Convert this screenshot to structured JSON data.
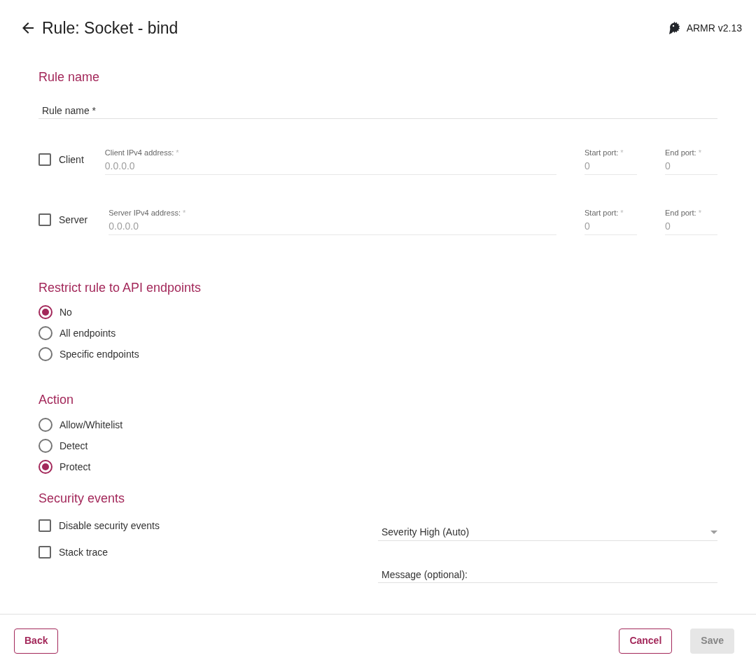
{
  "header": {
    "title": "Rule: Socket - bind",
    "version": "ARMR v2.13"
  },
  "rule_name": {
    "heading": "Rule name",
    "field": {
      "placeholder": "Rule name *"
    }
  },
  "endpoints": [
    {
      "label": "Client",
      "checked": false,
      "fields": [
        {
          "kind": "address",
          "label": "Client IPv4 address:",
          "required_mark": "*",
          "placeholder": "0.0.0.0"
        },
        {
          "kind": "port",
          "label": "Start port:",
          "required_mark": "*",
          "placeholder": "0"
        },
        {
          "kind": "port",
          "label": "End port:",
          "required_mark": "*",
          "placeholder": "0"
        }
      ]
    },
    {
      "label": "Server",
      "checked": false,
      "fields": [
        {
          "kind": "address",
          "label": "Server IPv4 address:",
          "required_mark": "*",
          "placeholder": "0.0.0.0"
        },
        {
          "kind": "port",
          "label": "Start port:",
          "required_mark": "*",
          "placeholder": "0"
        },
        {
          "kind": "port",
          "label": "End port:",
          "required_mark": "*",
          "placeholder": "0"
        }
      ]
    }
  ],
  "api_restriction": {
    "heading": "Restrict rule to API endpoints",
    "options": [
      {
        "label": "No",
        "selected": true
      },
      {
        "label": "All endpoints",
        "selected": false
      },
      {
        "label": "Specific endpoints",
        "selected": false
      }
    ]
  },
  "action": {
    "heading": "Action",
    "options": [
      {
        "label": "Allow/Whitelist",
        "selected": false
      },
      {
        "label": "Detect",
        "selected": false
      },
      {
        "label": "Protect",
        "selected": true
      }
    ]
  },
  "security_events": {
    "heading": "Security events",
    "checkboxes": [
      {
        "label": "Disable security events",
        "checked": false
      },
      {
        "label": "Stack trace",
        "checked": false
      }
    ],
    "severity": {
      "value": "Severity High (Auto)"
    },
    "message": {
      "placeholder": "Message (optional):"
    }
  },
  "footer": {
    "start_buttons": [
      {
        "label": "Back",
        "disabled": false
      }
    ],
    "end_buttons": [
      {
        "label": "Cancel",
        "disabled": false
      },
      {
        "label": "Save",
        "disabled": true
      }
    ]
  }
}
